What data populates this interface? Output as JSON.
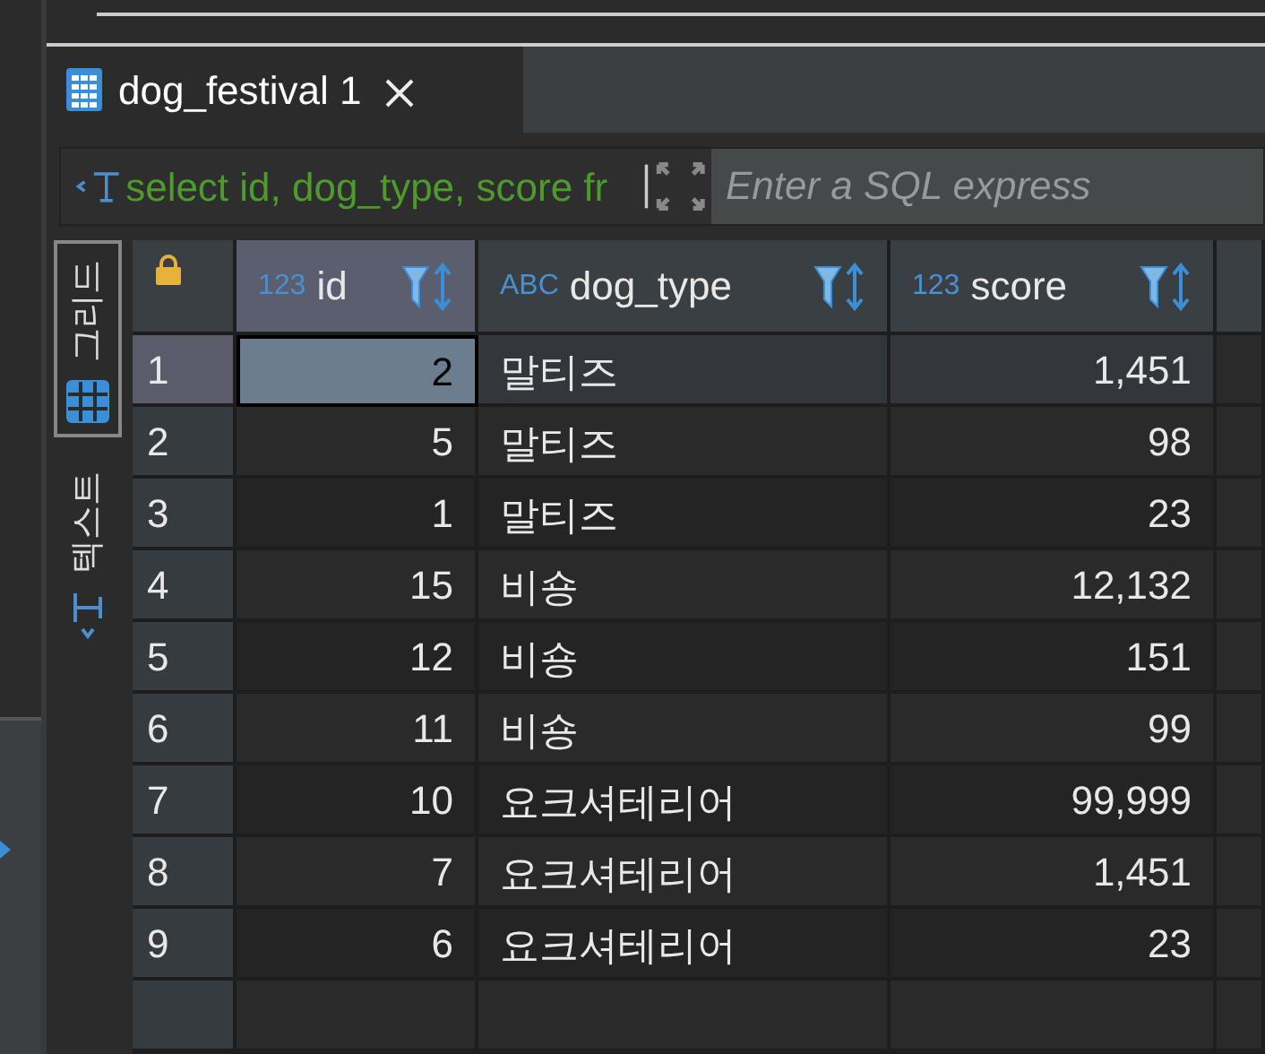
{
  "tab": {
    "title": "dog_festival 1"
  },
  "filter": {
    "query": "select id, dog_type, score fr",
    "placeholder": "Enter a SQL express"
  },
  "view_tabs": [
    {
      "label": "그리드",
      "kind": "grid",
      "selected": true
    },
    {
      "label": "텍스트",
      "kind": "text",
      "selected": false
    }
  ],
  "table": {
    "columns": [
      {
        "type": "123",
        "name": "id",
        "kind": "number",
        "selected": true
      },
      {
        "type": "ABC",
        "name": "dog_type",
        "kind": "text",
        "selected": false
      },
      {
        "type": "123",
        "name": "score",
        "kind": "number",
        "selected": false
      }
    ],
    "rows": [
      {
        "number": "1",
        "cells": [
          "2",
          "말티즈",
          "1,451"
        ],
        "selected": true
      },
      {
        "number": "2",
        "cells": [
          "5",
          "말티즈",
          "98"
        ],
        "selected": false
      },
      {
        "number": "3",
        "cells": [
          "1",
          "말티즈",
          "23"
        ],
        "selected": false
      },
      {
        "number": "4",
        "cells": [
          "15",
          "비숑",
          "12,132"
        ],
        "selected": false
      },
      {
        "number": "5",
        "cells": [
          "12",
          "비숑",
          "151"
        ],
        "selected": false
      },
      {
        "number": "6",
        "cells": [
          "11",
          "비숑",
          "99"
        ],
        "selected": false
      },
      {
        "number": "7",
        "cells": [
          "10",
          "요크셔테리어",
          "99,999"
        ],
        "selected": false
      },
      {
        "number": "8",
        "cells": [
          "7",
          "요크셔테리어",
          "1,451"
        ],
        "selected": false
      },
      {
        "number": "9",
        "cells": [
          "6",
          "요크셔테리어",
          "23"
        ],
        "selected": false
      }
    ]
  }
}
